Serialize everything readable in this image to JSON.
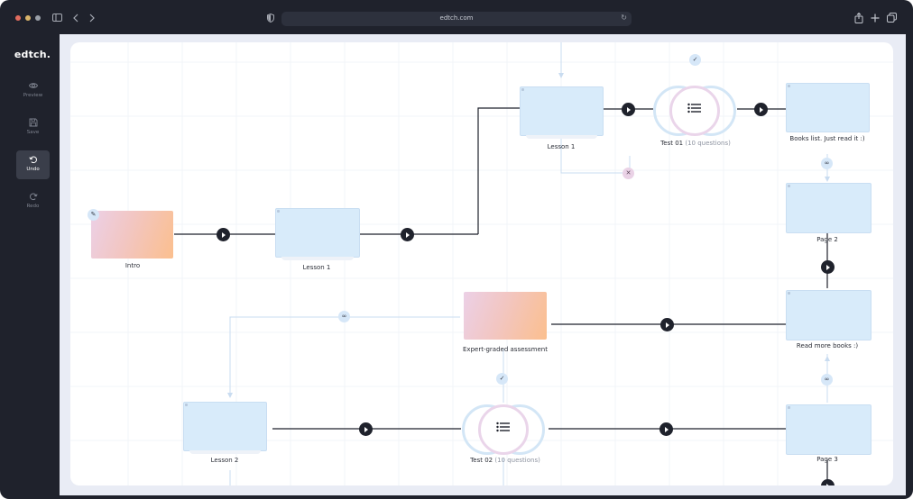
{
  "browser": {
    "url": "edtch.com",
    "icons": [
      "sidebar-toggle-icon",
      "back-icon",
      "forward-icon",
      "shield-icon",
      "reload-icon",
      "share-icon",
      "new-tab-icon",
      "tabs-icon"
    ]
  },
  "app": {
    "brand": "edtch.",
    "sidebar": [
      {
        "label": "Preview",
        "icon": "eye-icon",
        "active": false
      },
      {
        "label": "Save",
        "icon": "save-icon",
        "active": false
      },
      {
        "label": "Undo",
        "icon": "undo-icon",
        "active": true
      },
      {
        "label": "Redo",
        "icon": "redo-icon",
        "active": false
      }
    ]
  },
  "nodes": {
    "intro": "Intro",
    "lesson1_row": "Lesson 1",
    "lesson1_top": "Lesson 1",
    "test01": {
      "title": "Test 01",
      "detail": "(10 questions)"
    },
    "books_list": "Books list. Just read it :)",
    "page2": "Page 2",
    "expert": "Expert-graded assessment",
    "read_more": "Read more books :)",
    "lesson2": "Lesson 2",
    "test02": {
      "title": "Test 02",
      "detail": "(10 questions)"
    },
    "page3": "Page 3"
  },
  "colors": {
    "sidebar_bg": "#1f222c",
    "canvas_bg": "#e9ecf5",
    "node_blue": "#d8ebfa",
    "connector": "#1f222c",
    "link_line": "#c9dcf0"
  }
}
